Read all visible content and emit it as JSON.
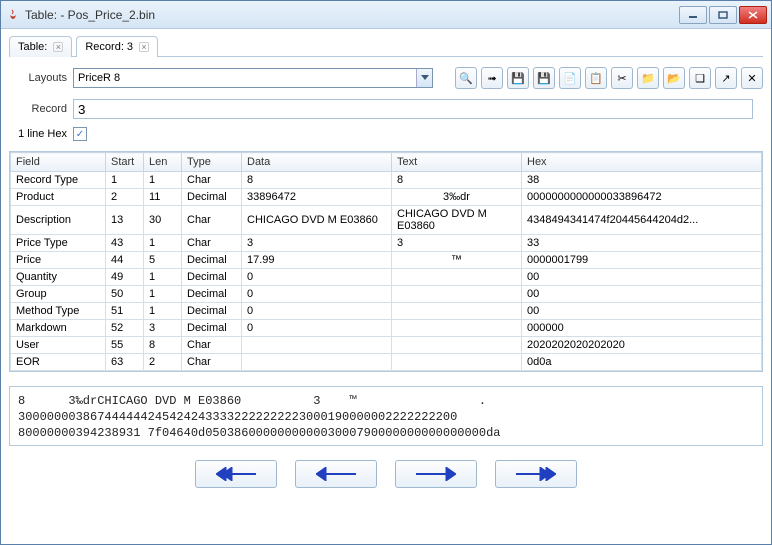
{
  "window": {
    "title": "Table: - Pos_Price_2.bin"
  },
  "tabs": [
    {
      "label": "Table:"
    },
    {
      "label": "Record: 3"
    }
  ],
  "form": {
    "layouts_label": "Layouts",
    "layouts_value": "PriceR 8",
    "record_label": "Record",
    "record_value": "3",
    "onelinehex_label": "1 line Hex",
    "onelinehex_checked": true
  },
  "toolbar_icons": [
    "find",
    "goto",
    "save",
    "save-as",
    "copy",
    "paste",
    "cut",
    "folder",
    "open",
    "new",
    "export",
    "delete"
  ],
  "columns": [
    "Field",
    "Start",
    "Len",
    "Type",
    "Data",
    "Text",
    "Hex"
  ],
  "rows": [
    {
      "field": "Record Type",
      "start": "1",
      "len": "1",
      "type": "Char",
      "data": "8",
      "text": "8",
      "hex": "38"
    },
    {
      "field": "Product",
      "start": "2",
      "len": "11",
      "type": "Decimal",
      "data": "33896472",
      "text": "3‰dr",
      "hex": "0000000000000033896472"
    },
    {
      "field": "Description",
      "start": "13",
      "len": "30",
      "type": "Char",
      "data": "CHICAGO DVD M E03860",
      "text": "CHICAGO DVD M E03860",
      "hex": "4348494341474f20445644204d2..."
    },
    {
      "field": "Price Type",
      "start": "43",
      "len": "1",
      "type": "Char",
      "data": "3",
      "text": "3",
      "hex": "33"
    },
    {
      "field": "Price",
      "start": "44",
      "len": "5",
      "type": "Decimal",
      "data": "17.99",
      "text": "™",
      "hex": "0000001799"
    },
    {
      "field": "Quantity",
      "start": "49",
      "len": "1",
      "type": "Decimal",
      "data": "0",
      "text": "",
      "hex": "00"
    },
    {
      "field": "Group",
      "start": "50",
      "len": "1",
      "type": "Decimal",
      "data": "0",
      "text": "",
      "hex": "00"
    },
    {
      "field": "Method Type",
      "start": "51",
      "len": "1",
      "type": "Decimal",
      "data": "0",
      "text": "",
      "hex": "00"
    },
    {
      "field": "Markdown",
      "start": "52",
      "len": "3",
      "type": "Decimal",
      "data": "0",
      "text": "",
      "hex": "000000"
    },
    {
      "field": "User",
      "start": "55",
      "len": "8",
      "type": "Char",
      "data": "",
      "text": "",
      "hex": "2020202020202020"
    },
    {
      "field": "EOR",
      "start": "63",
      "len": "2",
      "type": "Char",
      "data": "",
      "text": "",
      "hex": "0d0a"
    }
  ],
  "hexdump": {
    "line1": "8      3‰drCHICAGO DVD M E03860          3    ™                 .",
    "line2": "3000000038674444442454242433332222222223000190000002222222200",
    "line3": "80000000394238931 7f04640d050386000000000003000790000000000000000da"
  }
}
